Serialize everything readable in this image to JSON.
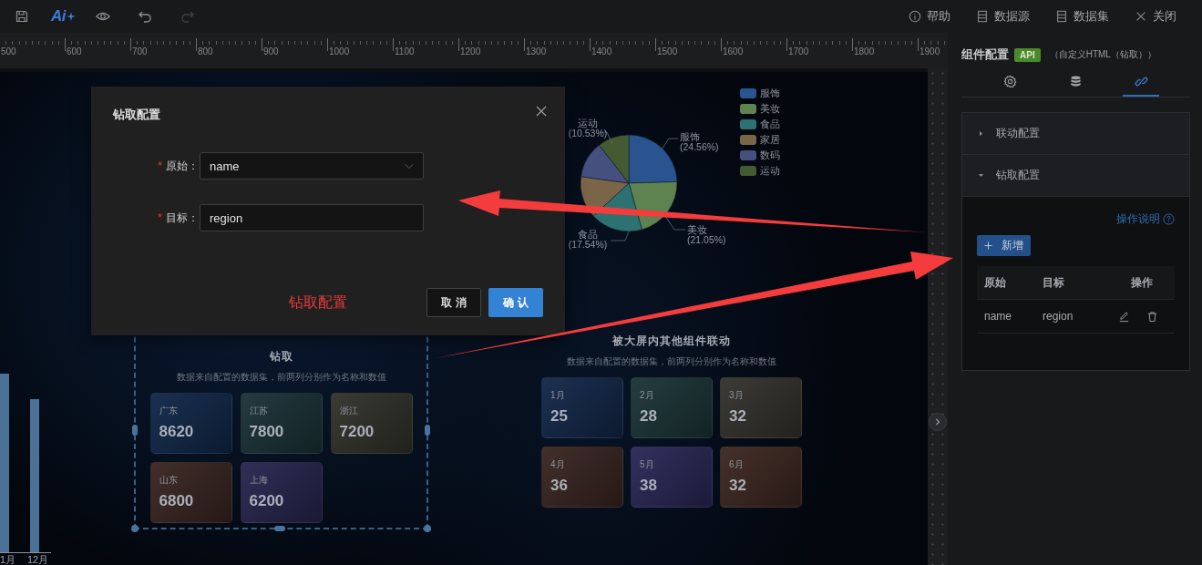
{
  "toolbar": {
    "logo": "Ai",
    "history": [
      {
        "kind": "undo",
        "disabled": false
      },
      {
        "kind": "redo",
        "disabled": true
      }
    ],
    "actions": [
      {
        "kind": "help",
        "label": "帮助"
      },
      {
        "kind": "datasource",
        "label": "数据源"
      },
      {
        "kind": "dataset",
        "label": "数据集"
      },
      {
        "kind": "close",
        "label": "关闭"
      }
    ]
  },
  "ruler": {
    "labels": [
      "500",
      "600",
      "700",
      "800",
      "900",
      "1000",
      "1100",
      "1200",
      "1300",
      "1400",
      "1500",
      "1600",
      "1700",
      "1800",
      "1900"
    ]
  },
  "canvas": {
    "bar_chart": {
      "x_labels": [
        "1月",
        "12月"
      ]
    },
    "pie_component": {
      "chart_data": {
        "type": "pie",
        "legend": "top-right",
        "categories": [
          "服饰",
          "美妆",
          "食品",
          "家居",
          "数码",
          "运动"
        ],
        "values": [
          24.56,
          21.05,
          17.54,
          14.04,
          12.28,
          10.53
        ],
        "colors": [
          "#2a5490",
          "#5e8350",
          "#2e7173",
          "#7a6548",
          "#46507e",
          "#445a30"
        ]
      },
      "slice_labels": [
        {
          "name": "运动",
          "percent": "(10.53%)"
        },
        {
          "name": "服饰",
          "percent": "(24.56%)"
        },
        {
          "name": "食品",
          "percent": "(17.54%)"
        },
        {
          "name": "美妆",
          "percent": "(21.05%)"
        }
      ]
    },
    "drill_component": {
      "title": "钻取",
      "subtitle": "数据来自配置的数据集，前两列分别作为名称和数值",
      "selected": true,
      "cards": [
        {
          "name": "广东",
          "value": "8620",
          "color": "#11284a"
        },
        {
          "name": "江苏",
          "value": "7800",
          "color": "#1b3338"
        },
        {
          "name": "浙江",
          "value": "7200",
          "color": "#33332c"
        },
        {
          "name": "山东",
          "value": "6800",
          "color": "#3a2622"
        },
        {
          "name": "上海",
          "value": "6200",
          "color": "#282650"
        }
      ]
    },
    "linkage_component": {
      "title": "被大屏内其他组件联动",
      "subtitle": "数据来自配置的数据集，前两列分别作为名称和数值",
      "cards": [
        {
          "name": "1月",
          "value": "25",
          "color": "#13284a"
        },
        {
          "name": "2月",
          "value": "28",
          "color": "#1c3538"
        },
        {
          "name": "3月",
          "value": "32",
          "color": "#35332e"
        },
        {
          "name": "4月",
          "value": "36",
          "color": "#3a2622"
        },
        {
          "name": "5月",
          "value": "38",
          "color": "#2b2858"
        },
        {
          "name": "6月",
          "value": "32",
          "color": "#3e2822"
        }
      ]
    }
  },
  "dialog": {
    "title": "钻取配置",
    "fields": [
      {
        "kind": "select",
        "required_mark": "*",
        "label": "原始：",
        "value": "name"
      },
      {
        "kind": "input",
        "required_mark": "*",
        "label": "目标：",
        "value": "region"
      }
    ],
    "annotation": "钻取配置",
    "buttons": [
      {
        "kind": "secondary",
        "label": "取 消"
      },
      {
        "kind": "primary",
        "label": "确 认"
      }
    ]
  },
  "panel": {
    "title": "组件配置",
    "badge": "API",
    "subtitle": "（自定义HTML（钻取））",
    "tabs": [
      {
        "kind": "style",
        "selected": false
      },
      {
        "kind": "data",
        "selected": false
      },
      {
        "kind": "interaction",
        "selected": true
      }
    ],
    "sections": [
      {
        "title": "联动配置",
        "expanded": false
      },
      {
        "title": "钻取配置",
        "expanded": true
      }
    ],
    "help_link": "操作说明",
    "add_button": "新增",
    "table": {
      "columns": [
        "原始",
        "目标",
        "操作"
      ],
      "rows": [
        {
          "source": "name",
          "target": "region"
        }
      ]
    }
  }
}
